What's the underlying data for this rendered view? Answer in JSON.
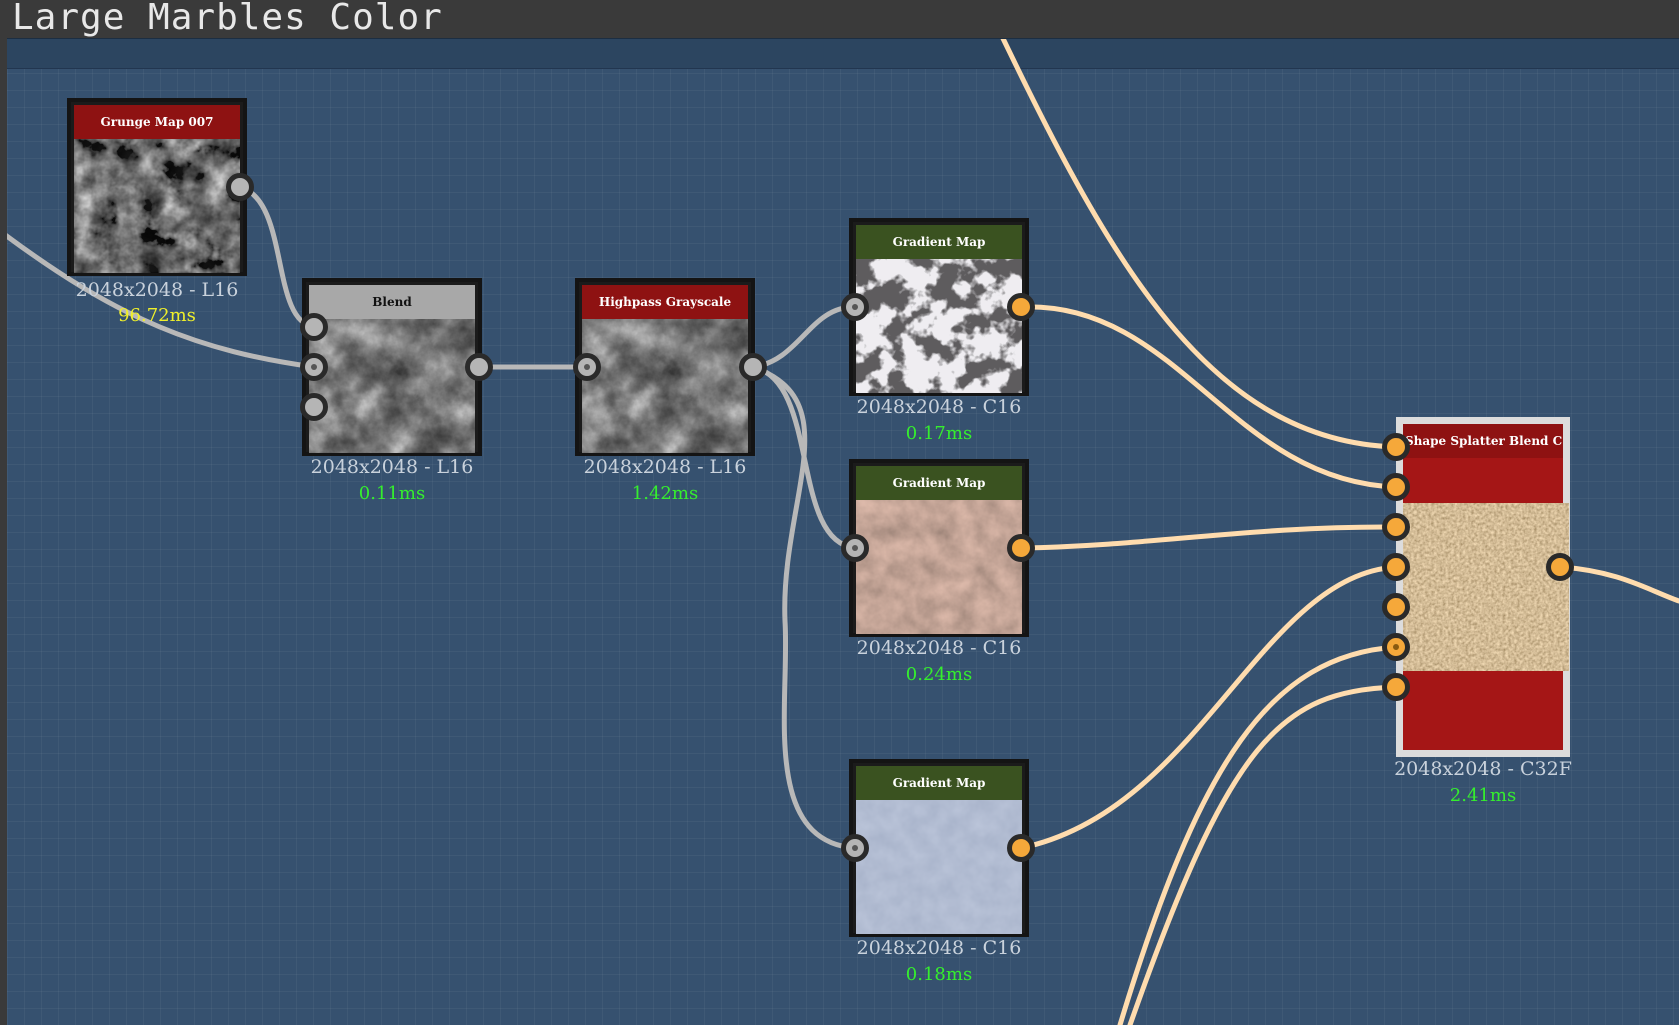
{
  "frame": {
    "title": "Large Marbles Color"
  },
  "colors": {
    "canvas": "#36516f",
    "grayscale_wire": "#b8b8b8",
    "color_wire": "#ffdcae",
    "port_orange": "#f5a83a",
    "header_red": "#8e1212",
    "header_green": "#3a5220",
    "header_grey": "#a8a8a8",
    "timing_green": "#35ee2e",
    "timing_yellow": "#f0f02a"
  },
  "nodes": {
    "grunge": {
      "title": "Grunge Map 007",
      "resolution": "2048x2048 - L16",
      "timing": "96.72ms",
      "thumbnail": "grunge-noise"
    },
    "blend": {
      "title": "Blend",
      "resolution": "2048x2048 - L16",
      "timing": "0.11ms",
      "thumbnail": "cloudy-gray"
    },
    "highpass": {
      "title": "Highpass Grayscale",
      "resolution": "2048x2048 - L16",
      "timing": "1.42ms",
      "thumbnail": "cloudy-gray"
    },
    "gradient1": {
      "title": "Gradient Map",
      "resolution": "2048x2048 - C16",
      "timing": "0.17ms",
      "thumbnail": "white-marble"
    },
    "gradient2": {
      "title": "Gradient Map",
      "resolution": "2048x2048 - C16",
      "timing": "0.24ms",
      "thumbnail": "brown-stone"
    },
    "gradient3": {
      "title": "Gradient Map",
      "resolution": "2048x2048 - C16",
      "timing": "0.18ms",
      "thumbnail": "blue-gray"
    },
    "splatter": {
      "title": "Shape Splatter Blend C…",
      "resolution": "2048x2048 - C32F",
      "timing": "2.41ms",
      "thumbnail": "sandy-gravel"
    }
  }
}
